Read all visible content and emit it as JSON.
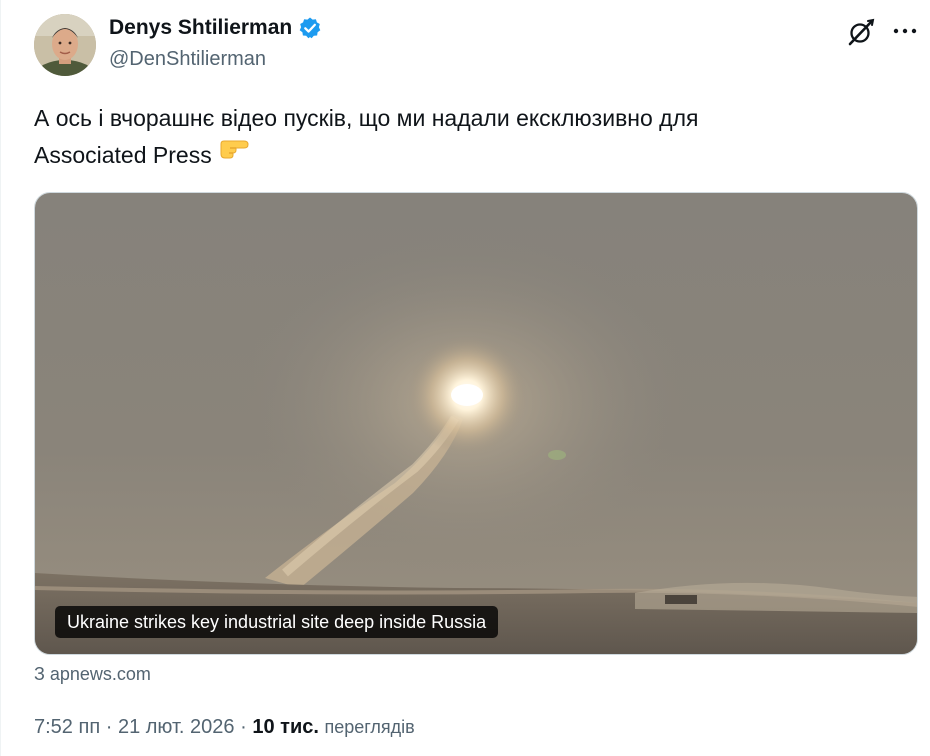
{
  "author": {
    "name": "Denys Shtilierman",
    "handle": "@DenShtilierman",
    "verified": true
  },
  "tweet": {
    "text_line1": "А ось і вчорашнє відео пусків, що ми надали ексклюзивно для",
    "text_line2": "Associated Press",
    "emoji": "👉"
  },
  "card": {
    "caption": "Ukraine strikes key industrial site deep inside Russia",
    "source": "З apnews.com"
  },
  "meta": {
    "time": "7:52 пп",
    "separator": "·",
    "date": "21 лют. 2026",
    "views_count": "10 тис.",
    "views_label": "переглядів"
  },
  "icons": {
    "verified": "verified-badge-icon",
    "grok": "grok-icon",
    "more": "more-options-icon"
  },
  "colors": {
    "accent": "#1d9bf0",
    "text": "#0f1419",
    "secondary": "#536471",
    "border": "#cfd9de"
  }
}
